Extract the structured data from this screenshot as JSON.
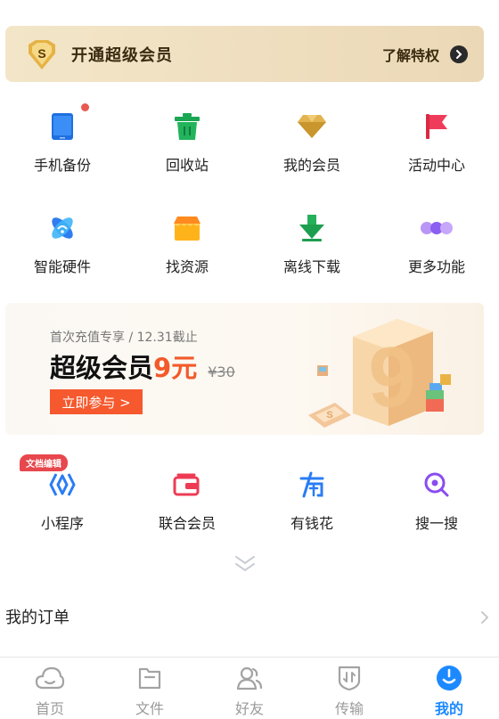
{
  "vip_banner": {
    "title": "开通超级会员",
    "link": "了解特权",
    "badge_letter": "S"
  },
  "tools_row1": [
    {
      "label": "手机备份",
      "icon": "phone-backup-icon"
    },
    {
      "label": "回收站",
      "icon": "recycle-bin-icon"
    },
    {
      "label": "我的会员",
      "icon": "diamond-icon"
    },
    {
      "label": "活动中心",
      "icon": "flag-icon"
    }
  ],
  "tools_row2": [
    {
      "label": "智能硬件",
      "icon": "smart-hardware-icon"
    },
    {
      "label": "找资源",
      "icon": "store-icon"
    },
    {
      "label": "离线下载",
      "icon": "download-arrow-icon"
    },
    {
      "label": "更多功能",
      "icon": "more-dots-icon"
    }
  ],
  "promo": {
    "subtitle": "首次充值专享 / 12.31截止",
    "headline": "超级会员",
    "price": "9元",
    "original_price": "¥30",
    "cta": "立即参与 >",
    "art_number": "9"
  },
  "tools_row3": [
    {
      "label": "小程序",
      "icon": "mini-program-icon",
      "badge": "文档编辑"
    },
    {
      "label": "联合会员",
      "icon": "wallet-card-icon"
    },
    {
      "label": "有钱花",
      "icon": "finance-icon"
    },
    {
      "label": "搜一搜",
      "icon": "search-icon"
    }
  ],
  "orders": {
    "title": "我的订单"
  },
  "tabbar": [
    {
      "label": "首页",
      "icon": "cloud-home-icon",
      "active": false
    },
    {
      "label": "文件",
      "icon": "folder-icon",
      "active": false
    },
    {
      "label": "好友",
      "icon": "friends-icon",
      "active": false
    },
    {
      "label": "传输",
      "icon": "transfer-icon",
      "active": false
    },
    {
      "label": "我的",
      "icon": "profile-icon",
      "active": true
    }
  ],
  "colors": {
    "accent": "#1c89ff",
    "promo_orange": "#f5592d",
    "badge_red": "#e7474d",
    "banner_gold": "#f0e1c2"
  }
}
